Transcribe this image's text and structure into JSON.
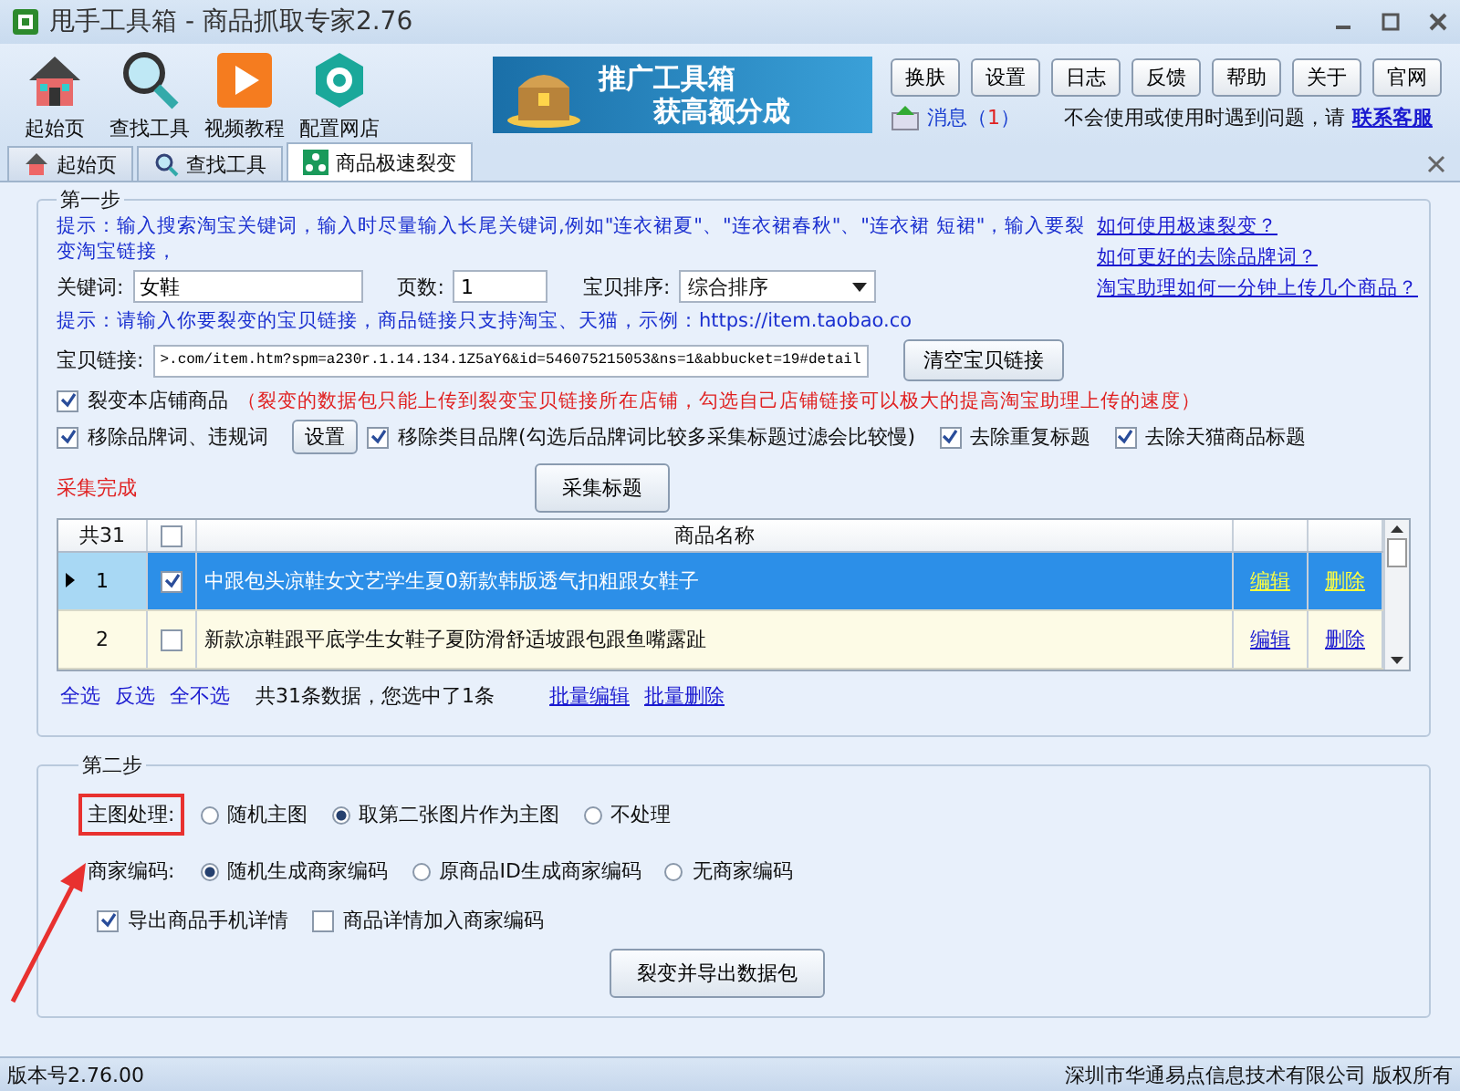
{
  "window": {
    "title": "甩手工具箱 - 商品抓取专家2.76"
  },
  "toolbar": [
    {
      "label": "起始页",
      "kind": "home"
    },
    {
      "label": "查找工具",
      "kind": "search"
    },
    {
      "label": "视频教程",
      "kind": "video"
    },
    {
      "label": "配置网店",
      "kind": "config"
    }
  ],
  "banner": {
    "line1": "推广工具箱",
    "line2": "获高额分成"
  },
  "top_buttons": [
    "换肤",
    "设置",
    "日志",
    "反馈",
    "帮助",
    "关于",
    "官网"
  ],
  "message": {
    "prefix": "消息（",
    "count": "1",
    "suffix": "）"
  },
  "help": {
    "text": "不会使用或使用时遇到问题，请",
    "link": "联系客服"
  },
  "tabs": [
    {
      "label": "起始页",
      "kind": "home",
      "selected": false
    },
    {
      "label": "查找工具",
      "kind": "search",
      "selected": false
    },
    {
      "label": "商品极速裂变",
      "kind": "split",
      "selected": true
    }
  ],
  "step1": {
    "title": "第一步",
    "hint1": "提示：输入搜索淘宝关键词，输入时尽量输入长尾关键词,例如\"连衣裙夏\"、\"连衣裙春秋\"、\"连衣裙 短裙\"，输入要裂变淘宝链接，",
    "links": [
      "如何使用极速裂变？",
      "如何更好的去除品牌词？",
      "淘宝助理如何一分钟上传几个商品？"
    ],
    "keyword": {
      "label": "关键词:",
      "value": "女鞋"
    },
    "pages": {
      "label": "页数:",
      "value": "1"
    },
    "sort": {
      "label": "宝贝排序:",
      "value": "综合排序"
    },
    "hint2": "提示：请输入你要裂变的宝贝链接，商品链接只支持淘宝、天猫，示例：https://item.taobao.co",
    "link_field": {
      "label": "宝贝链接:",
      "value": ">.com/item.htm?spm=a230r.1.14.134.1Z5aY6&id=546075215053&ns=1&abbucket=19#detail"
    },
    "clear_button": "清空宝贝链接",
    "shop_option": {
      "label": "裂变本店铺商品",
      "checked": true,
      "note": "（裂变的数据包只能上传到裂变宝贝链接所在店铺，勾选自己店铺链接可以极大的提高淘宝助理上传的速度）"
    },
    "filters": [
      {
        "kind": "checkbox",
        "label": "移除品牌词、违规词",
        "checked": true
      },
      {
        "kind": "button",
        "label": "设置"
      },
      {
        "kind": "checkbox",
        "label": "移除类目品牌(勾选后品牌词比较多采集标题过滤会比较慢)",
        "checked": true
      },
      {
        "kind": "checkbox",
        "label": "去除重复标题",
        "checked": true
      },
      {
        "kind": "checkbox",
        "label": "去除天猫商品标题",
        "checked": true
      }
    ],
    "status": "采集完成",
    "collect_button": "采集标题"
  },
  "table": {
    "count": "共31",
    "header_checked": false,
    "column": "商品名称",
    "rows": [
      {
        "index": "1",
        "checked": true,
        "selected": true,
        "title": "中跟包头凉鞋女文艺学生夏0新款韩版透气扣粗跟女鞋子",
        "edit": "编辑",
        "delete": "删除"
      },
      {
        "index": "2",
        "checked": false,
        "selected": false,
        "title": "新款凉鞋跟平底学生女鞋子夏防滑舒适坡跟包跟鱼嘴露趾",
        "edit": "编辑",
        "delete": "删除"
      }
    ],
    "select_links": [
      "全选",
      "反选",
      "全不选"
    ],
    "summary": "共31条数据，您选中了1条",
    "batch_links": [
      "批量编辑",
      "批量删除"
    ]
  },
  "step2": {
    "title": "第二步",
    "main_image": {
      "label": "主图处理:",
      "highlighted": true,
      "options": [
        {
          "label": "随机主图",
          "selected": false
        },
        {
          "label": "取第二张图片作为主图",
          "selected": true
        },
        {
          "label": "不处理",
          "selected": false
        }
      ]
    },
    "merchant_code": {
      "label": "商家编码:",
      "options": [
        {
          "label": "随机生成商家编码",
          "selected": true
        },
        {
          "label": "原商品ID生成商家编码",
          "selected": false
        },
        {
          "label": "无商家编码",
          "selected": false
        }
      ]
    },
    "exports": [
      {
        "label": "导出商品手机详情",
        "checked": true
      },
      {
        "label": "商品详情加入商家编码",
        "checked": false
      }
    ],
    "export_button": "裂变并导出数据包"
  },
  "status_bar": {
    "version": "版本号2.76.00",
    "copyright": "深圳市华通易点信息技术有限公司 版权所有"
  }
}
